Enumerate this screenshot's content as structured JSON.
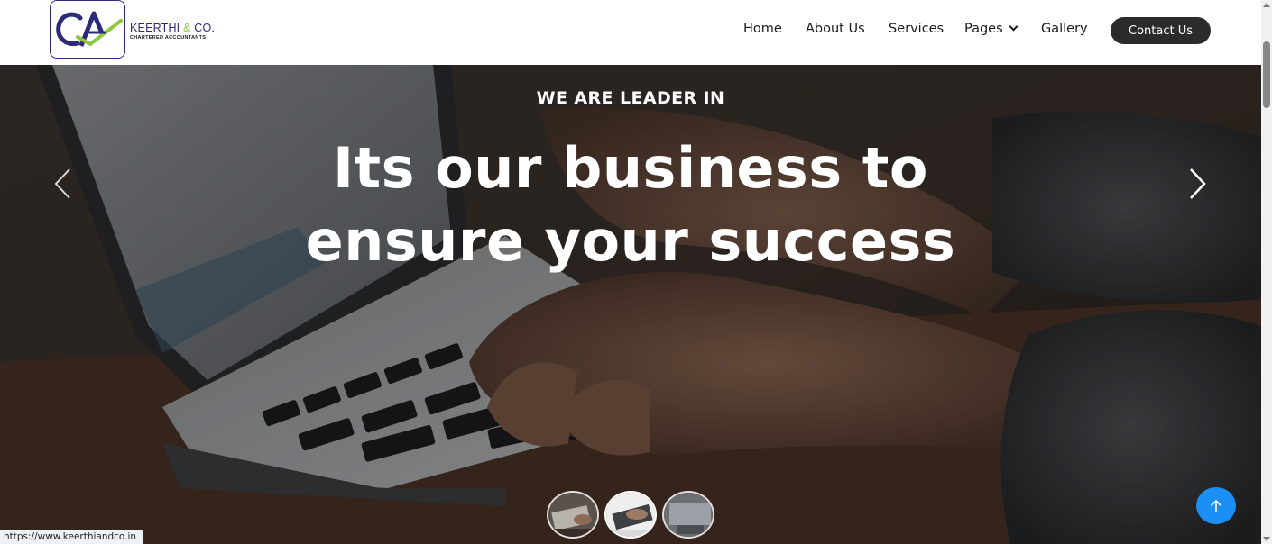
{
  "brand": {
    "name_main": "KEERTHI ",
    "name_amp": "&",
    "name_tail": " CO.",
    "subtitle": "CHARTERED ACCOUNTANTS",
    "logo_text": "CA"
  },
  "nav": {
    "home": "Home",
    "about": "About Us",
    "services": "Services",
    "pages": "Pages",
    "gallery": "Gallery",
    "contact": "Contact Us"
  },
  "hero": {
    "kicker": "WE ARE LEADER IN",
    "headline_line1": "Its our business to",
    "headline_line2": "ensure your success",
    "slides_count": 3,
    "active_slide": 2
  },
  "status_bar": {
    "url": "https://www.keerthiandco.in"
  },
  "colors": {
    "brand_navy": "#2e2a7a",
    "brand_green": "#8dc63f",
    "contact_button": "#2b2b2b",
    "scroll_top_button": "#1a8ff5"
  },
  "icons": {
    "prev": "chevron-left-icon",
    "next": "chevron-right-icon",
    "pages_dropdown": "chevron-down-icon",
    "scroll_top": "arrow-up-icon"
  }
}
